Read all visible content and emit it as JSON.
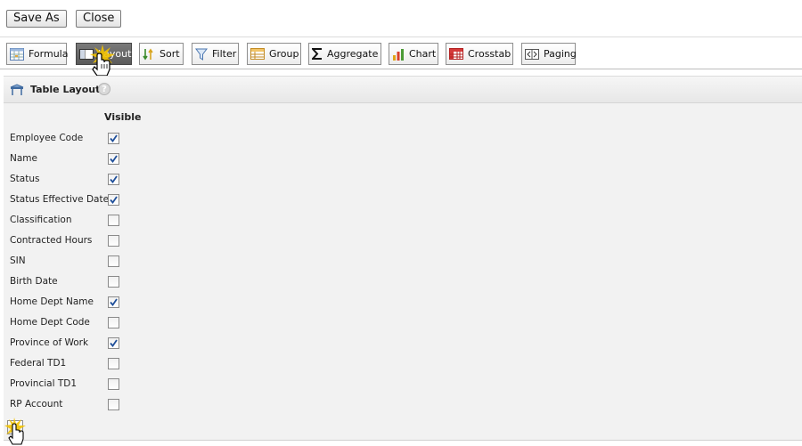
{
  "top_buttons": {
    "save_as": "Save As",
    "close": "Close"
  },
  "toolbar": {
    "items": [
      {
        "label": "Formula",
        "icon": "formula-icon"
      },
      {
        "label": "Layout",
        "icon": "layout-icon",
        "active": true
      },
      {
        "label": "Sort",
        "icon": "sort-icon"
      },
      {
        "label": "Filter",
        "icon": "filter-icon"
      },
      {
        "label": "Group",
        "icon": "group-icon"
      },
      {
        "label": "Aggregate",
        "icon": "sigma-icon"
      },
      {
        "label": "Chart",
        "icon": "bar-chart-icon"
      },
      {
        "label": "Crosstab",
        "icon": "crosstab-icon"
      },
      {
        "label": "Paging",
        "icon": "paging-icon"
      }
    ]
  },
  "panel": {
    "title": "Table Layout",
    "help": "?",
    "column_header": "Visible",
    "rows": [
      {
        "label": "Employee Code",
        "visible": true
      },
      {
        "label": "Name",
        "visible": true
      },
      {
        "label": "Status",
        "visible": true
      },
      {
        "label": "Status Effective Date",
        "visible": true
      },
      {
        "label": "Classification",
        "visible": false
      },
      {
        "label": "Contracted Hours",
        "visible": false
      },
      {
        "label": "SIN",
        "visible": false
      },
      {
        "label": "Birth Date",
        "visible": false
      },
      {
        "label": "Home Dept Name",
        "visible": true
      },
      {
        "label": "Home Dept Code",
        "visible": false
      },
      {
        "label": "Province of Work",
        "visible": true
      },
      {
        "label": "Federal TD1",
        "visible": false
      },
      {
        "label": "Provincial TD1",
        "visible": false
      },
      {
        "label": "RP Account",
        "visible": false
      }
    ]
  },
  "colors": {
    "check": "#1f4f9a",
    "active_button": "#6a6a6a",
    "click_burst": "#f2c200"
  }
}
